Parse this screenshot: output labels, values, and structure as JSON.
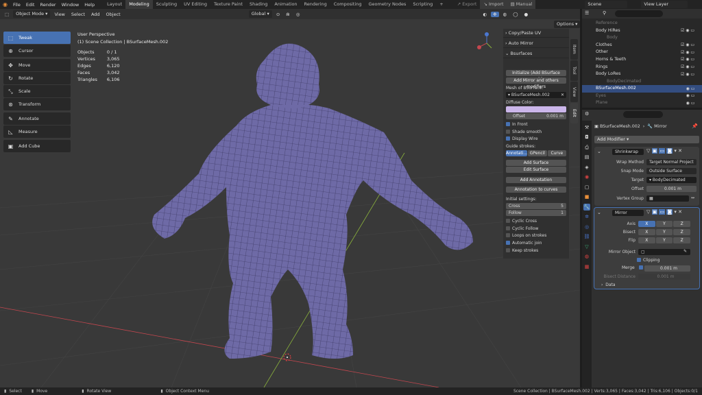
{
  "menu": [
    "File",
    "Edit",
    "Render",
    "Window",
    "Help"
  ],
  "workspaces": [
    "Layout",
    "Modeling",
    "Sculpting",
    "UV Editing",
    "Texture Paint",
    "Shading",
    "Animation",
    "Rendering",
    "Compositing",
    "Geometry Nodes",
    "Scripting"
  ],
  "active_workspace": "Modeling",
  "top_right": {
    "export": "Export",
    "import": "Import",
    "manual": "Manual",
    "scene": "Scene",
    "view_layer": "View Layer"
  },
  "viewport_header": {
    "mode": "Object Mode",
    "view": "View",
    "select": "Select",
    "add": "Add",
    "object": "Object",
    "transform": "Global",
    "options": "Options"
  },
  "tools": [
    {
      "label": "Tweak",
      "icon": "tweak-icon",
      "active": true
    },
    {
      "label": "Cursor",
      "icon": "cursor-icon"
    },
    {
      "label": "Move",
      "icon": "move-icon"
    },
    {
      "label": "Rotate",
      "icon": "rotate-icon"
    },
    {
      "label": "Scale",
      "icon": "scale-icon"
    },
    {
      "label": "Transform",
      "icon": "transform-icon"
    },
    {
      "label": "Annotate",
      "icon": "annotate-icon"
    },
    {
      "label": "Measure",
      "icon": "measure-icon"
    },
    {
      "label": "Add Cube",
      "icon": "add-cube-icon"
    }
  ],
  "overlay": {
    "title": "User Perspective",
    "collection": "(1) Scene Collection | BSurfaceMesh.002",
    "stats": [
      [
        "Objects",
        "0 / 1"
      ],
      [
        "Vertices",
        "3,065"
      ],
      [
        "Edges",
        "6,120"
      ],
      [
        "Faces",
        "3,042"
      ],
      [
        "Triangles",
        "6,106"
      ]
    ]
  },
  "npanel": {
    "copy_paste_uv": "Copy/Paste UV",
    "auto_mirror": "Auto Mirror",
    "bsurfaces": "Bsurfaces",
    "init_btn": "Initialize (Add BSurface mesh)",
    "add_mirror_btn": "Add Mirror and others modifiers",
    "mesh_label": "Mesh of BSurface:",
    "mesh_value": "BSurfaceMesh.002",
    "diffuse_label": "Diffuse Color:",
    "offset_label": "Offset",
    "offset_value": "0.001 m",
    "in_front": "In Front",
    "shade_smooth": "Shade smooth",
    "display_wire": "Display Wire",
    "guide_label": "Guide strokes:",
    "guide_tabs": [
      "Annotati...",
      "GPencil",
      "Curve"
    ],
    "add_surface": "Add Surface",
    "edit_surface": "Edit Surface",
    "add_annotation": "Add Annotation",
    "annotation_to_curves": "Annotation to curves",
    "initial_label": "Initial settings:",
    "cross_label": "Cross",
    "cross_value": "5",
    "follow_label": "Follow",
    "follow_value": "1",
    "cyclic_cross": "Cyclic Cross",
    "cyclic_follow": "Cyclic Follow",
    "loops_on_strokes": "Loops on strokes",
    "automatic_join": "Automatic join",
    "keep_strokes": "Keep strokes"
  },
  "vtabs": [
    "Item",
    "Tool",
    "View",
    "Edit"
  ],
  "outliner": [
    {
      "name": "Reference",
      "indent": 1,
      "dim": true
    },
    {
      "name": "Body HiRes",
      "indent": 1
    },
    {
      "name": "Body",
      "indent": 2,
      "dim": true
    },
    {
      "name": "Clothes",
      "indent": 1
    },
    {
      "name": "Other",
      "indent": 1
    },
    {
      "name": "Horns & Teeth",
      "indent": 1
    },
    {
      "name": "Rings",
      "indent": 1
    },
    {
      "name": "Body LoRes",
      "indent": 1
    },
    {
      "name": "BodyDecimated",
      "indent": 2,
      "dim": true
    },
    {
      "name": "BSurfaceMesh.002",
      "indent": 1,
      "selected": true
    },
    {
      "name": "Eyes",
      "indent": 1,
      "dim": true
    },
    {
      "name": "Plane",
      "indent": 1,
      "dim": true
    }
  ],
  "properties": {
    "object": "BSurfaceMesh.002",
    "modifier_name": "Mirror",
    "add_modifier": "Add Modifier",
    "shrinkwrap": {
      "name": "Shrinkwrap",
      "wrap_method_label": "Wrap Method",
      "wrap_method": "Target Normal Project",
      "snap_mode_label": "Snap Mode",
      "snap_mode": "Outside Surface",
      "target_label": "Target",
      "target": "BodyDecimated",
      "offset_label": "Offset",
      "offset": "0.001 m",
      "vertex_group_label": "Vertex Group"
    },
    "mirror": {
      "name": "Mirror",
      "axis_label": "Axis",
      "bisect_label": "Bisect",
      "flip_label": "Flip",
      "axes": [
        "X",
        "Y",
        "Z"
      ],
      "mirror_object_label": "Mirror Object",
      "clipping": "Clipping",
      "merge_label": "Merge",
      "merge": "0.001 m",
      "bisect_distance_label": "Bisect Distance",
      "bisect_distance": "0.001 m",
      "data": "Data"
    }
  },
  "status": {
    "select": "Select",
    "move": "Move",
    "rotate": "Rotate View",
    "context": "Object Context Menu",
    "right": "Scene Collection | BSurfaceMesh.002 | Verts:3,065 | Faces:3,042 | Tris:6,106 | Objects:0/1"
  },
  "colors": {
    "accent": "#4772b3",
    "mesh": "#6e6aa6",
    "diffuse": "#cbb6ea",
    "x_axis": "#c5474f",
    "y_axis": "#8bb33c"
  }
}
